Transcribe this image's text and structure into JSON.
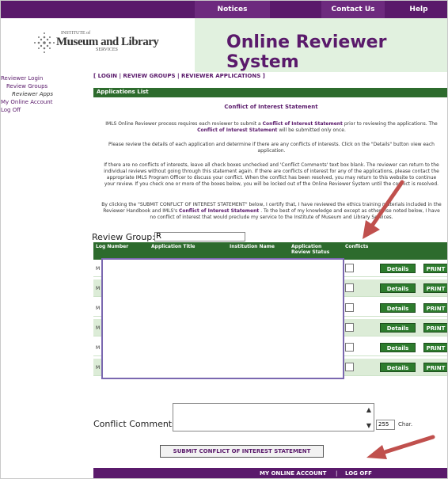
{
  "topnav": {
    "notices": "Notices",
    "contact": "Contact Us",
    "help": "Help"
  },
  "logo": {
    "line1": "INSTITUTE of",
    "line2": "Museum and Library",
    "line3": "SERVICES"
  },
  "site_title": "Online Reviewer System",
  "sidebar": {
    "items": [
      "Reviewer Login",
      "Review Groups",
      "Reviewer Apps",
      "My Online Account",
      "Log Off"
    ]
  },
  "breadcrumbs": "[ LOGIN | REVIEW GROUPS | REVIEWER APPLICATIONS ]",
  "section_label": "Applications List",
  "coi_title": "Conflict of Interest Statement",
  "para1": {
    "pre": "IMLS Online Reviewer process requires each reviewer to submit a",
    "link1": "Conflict of Interest Statement",
    "mid": "prior to reviewing the applications. The",
    "link2": "Conflict of Interest Statement",
    "post": "will be submitted only once."
  },
  "para2": "Please review the details of each application and determine if there are any conflicts of interests. Click on the \"Details\" button view each application.",
  "para3": "If there are no conflicts of interests, leave all check boxes unchecked and 'Conflict Comments' text box blank. The reviewer can return to the individual reviews without going through this statement again. If there are conflicts of interest for any of the applications, please contact the appropriate IMLS Program Officer to discuss your conflict. When the conflict has been resolved, you may return to this website to continue your review. If you check one or more of the boxes below, you will be locked out of the Online Reviewer System until the conflict is resolved.",
  "para4": {
    "pre": "By clicking the \"SUBMIT CONFLICT OF INTEREST STATEMENT\" below, I certify that, I have reviewed the ethics training materials included in the Reviewer Handbook and IMLS's",
    "link": "Conflict of Interest Statement",
    "post": ". To the best of my knowledge and except as otherwise noted below, I have no conflict of interest that would preclude my service to the Institute of Museum and Library Services."
  },
  "review_group_label": "Review Group:",
  "review_group_value": "R",
  "table": {
    "headers": [
      "Log Number",
      "Application Title",
      "Institution Name",
      "Application Review Status",
      "Conflicts"
    ],
    "rows": [
      {
        "log": "M",
        "details": "Details",
        "print": "PRINT"
      },
      {
        "log": "M",
        "details": "Details",
        "print": "PRINT"
      },
      {
        "log": "M",
        "details": "Details",
        "print": "PRINT"
      },
      {
        "log": "M",
        "details": "Details",
        "print": "PRINT"
      },
      {
        "log": "M",
        "details": "Details",
        "print": "PRINT"
      },
      {
        "log": "M",
        "details": "Details",
        "print": "PRINT"
      }
    ]
  },
  "comments": {
    "label": "Conflict Comments:",
    "char_count": "255",
    "char_label": "Char."
  },
  "submit_label": "SUBMIT CONFLICT OF INTEREST STATEMENT",
  "footer": {
    "account": "MY ONLINE ACCOUNT",
    "sep": "|",
    "logoff": "LOG OFF"
  },
  "colors": {
    "purple": "#5a1a6b",
    "green": "#2d6b2d",
    "light_green": "#e1f1df",
    "arrow": "#c0504d"
  }
}
